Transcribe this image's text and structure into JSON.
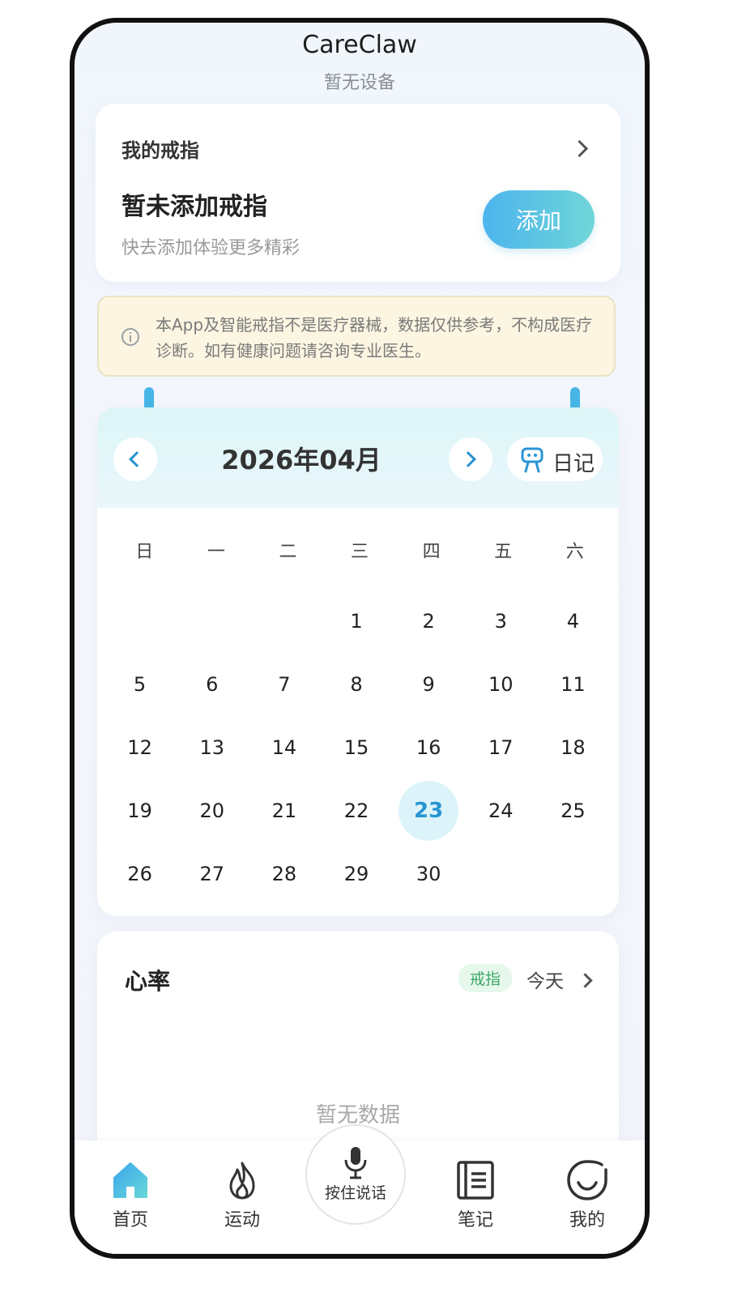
{
  "header": {
    "app_name": "CareClaw",
    "device_status": "暂无设备"
  },
  "ring_card": {
    "heading": "我的戒指",
    "title": "暂未添加戒指",
    "description": "快去添加体验更多精彩",
    "add_button": "添加"
  },
  "notice": {
    "text": "本App及智能戒指不是医疗器械，数据仅供参考，不构成医疗诊断。如有健康问题请咨询专业医生。"
  },
  "calendar": {
    "month_label": "2026年04月",
    "diary_button": "日记",
    "weekdays": [
      "日",
      "一",
      "二",
      "三",
      "四",
      "五",
      "六"
    ],
    "first_weekday_index": 3,
    "days": [
      "1",
      "2",
      "3",
      "4",
      "5",
      "6",
      "7",
      "8",
      "9",
      "10",
      "11",
      "12",
      "13",
      "14",
      "15",
      "16",
      "17",
      "18",
      "19",
      "20",
      "21",
      "22",
      "23",
      "24",
      "25",
      "26",
      "27",
      "28",
      "29",
      "30"
    ],
    "today": "23"
  },
  "heart_rate": {
    "title": "心率",
    "source_tag": "戒指",
    "period": "今天",
    "empty_text": "暂无数据"
  },
  "tabbar": {
    "home": "首页",
    "sport": "运动",
    "voice": "按住说话",
    "notes": "笔记",
    "mine": "我的"
  },
  "colors": {
    "accent": "#2a94d4",
    "today_bg": "#dcf3fa",
    "tag_green": "#3ea765"
  },
  "icons": [
    "home-icon",
    "flame-icon",
    "mic-icon",
    "notebook-icon",
    "smile-icon",
    "robot-icon",
    "info-icon"
  ]
}
